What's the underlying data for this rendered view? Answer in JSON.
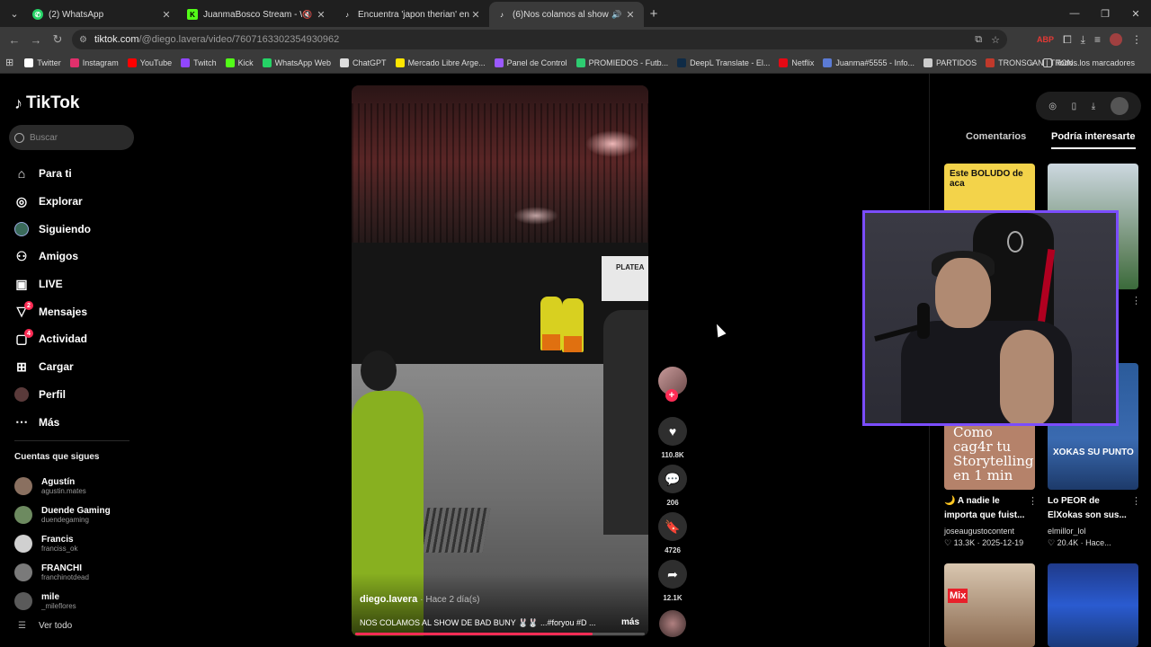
{
  "browser": {
    "tabs": [
      {
        "title": "(2) WhatsApp",
        "icon": "whatsapp-icon",
        "active": false
      },
      {
        "title": "JuanmaBosco Stream - Wat",
        "icon": "kick-icon",
        "active": false
      },
      {
        "title": "Encuentra 'japon therian' en Tik",
        "icon": "tiktok-icon",
        "active": false
      },
      {
        "title": "(6)Nos colamos al show de",
        "icon": "tiktok-icon",
        "active": true
      }
    ],
    "url_host": "tiktok.com",
    "url_path": "/@diego.lavera/video/7607163302354930962",
    "bookmarks": [
      {
        "label": "Twitter",
        "color": "#ffffff"
      },
      {
        "label": "Instagram",
        "color": "#e1306c"
      },
      {
        "label": "YouTube",
        "color": "#ff0000"
      },
      {
        "label": "Twitch",
        "color": "#9146ff"
      },
      {
        "label": "Kick",
        "color": "#53fc18"
      },
      {
        "label": "WhatsApp Web",
        "color": "#25d366"
      },
      {
        "label": "ChatGPT",
        "color": "#dddddd"
      },
      {
        "label": "Mercado Libre Arge...",
        "color": "#ffe600"
      },
      {
        "label": "Panel de Control",
        "color": "#9b59ff"
      },
      {
        "label": "PROMIEDOS - Futb...",
        "color": "#2ecc71"
      },
      {
        "label": "DeepL Translate - El...",
        "color": "#0f2b46"
      },
      {
        "label": "Netflix",
        "color": "#e50914"
      },
      {
        "label": "Juanma#5555 - Info...",
        "color": "#5b7bd5"
      },
      {
        "label": "PARTIDOS",
        "color": "#cccccc"
      },
      {
        "label": "TRONSCAN | TRON...",
        "color": "#c0392b"
      }
    ],
    "all_bookmarks": "Todos los marcadores"
  },
  "sidebar": {
    "logo": "TikTok",
    "search_placeholder": "Buscar",
    "nav": [
      {
        "label": "Para ti",
        "icon": "home-icon"
      },
      {
        "label": "Explorar",
        "icon": "compass-icon"
      },
      {
        "label": "Siguiendo",
        "icon": "following-icon"
      },
      {
        "label": "Amigos",
        "icon": "friends-icon"
      },
      {
        "label": "LIVE",
        "icon": "live-icon"
      },
      {
        "label": "Mensajes",
        "icon": "messages-icon",
        "badge": "2"
      },
      {
        "label": "Actividad",
        "icon": "activity-icon",
        "badge": "4"
      },
      {
        "label": "Cargar",
        "icon": "upload-icon"
      },
      {
        "label": "Perfil",
        "icon": "profile-avatar"
      },
      {
        "label": "Más",
        "icon": "more-icon"
      }
    ],
    "following_title": "Cuentas que sigues",
    "following": [
      {
        "name": "Agustín",
        "handle": "agustin.mates",
        "color": "#8a7060"
      },
      {
        "name": "Duende Gaming",
        "handle": "duendegaming",
        "color": "#6d8a60"
      },
      {
        "name": "Francis",
        "handle": "franciss_ok",
        "color": "#d0d0d0"
      },
      {
        "name": "FRANCHI",
        "handle": "franchinotdead",
        "color": "#7a7a7a"
      },
      {
        "name": "mile",
        "handle": "_mileflores",
        "color": "#5a5a5a"
      }
    ],
    "see_all": "Ver todo"
  },
  "video": {
    "author": "diego.lavera",
    "time_ago": "· Hace 2 día(s)",
    "caption": "NOS COLAMOS AL SHOW DE BAD BUNY 🐰🐰 ...#foryou #D ...",
    "more": "más",
    "sign_text": "PLATEA",
    "progress": 0.82,
    "actions": {
      "likes": "110.8K",
      "comments": "206",
      "saves": "4726",
      "shares": "12.1K"
    }
  },
  "right_panel": {
    "tab_comments": "Comentarios",
    "tab_suggested": "Podría interesarte",
    "cards": [
      {
        "thumb_text": "Este BOLUDO de aca",
        "title": "",
        "author": "",
        "stats": ""
      },
      {
        "thumb_text": "",
        "title": "",
        "author": "",
        "stats": ""
      },
      {
        "thumb_text": "Como cag4r tu Storytelling en 1 min",
        "title": "🌙 A nadie le importa que fuist...",
        "author": "joseaugustocontent",
        "stats": "♡ 13.3K · 2025-12-19"
      },
      {
        "thumb_text": "XOKAS SU PUNTO",
        "title": "Lo PEOR de ElXokas son sus...",
        "author": "elmillor_lol",
        "stats": "♡ 20.4K · Hace..."
      },
      {
        "thumb_text": "Mix",
        "title": "",
        "author": "",
        "stats": ""
      },
      {
        "thumb_text": "",
        "title": "",
        "author": "",
        "stats": ""
      }
    ]
  },
  "colors": {
    "accent": "#fe2c55",
    "webcam_border": "#7b4dff"
  }
}
